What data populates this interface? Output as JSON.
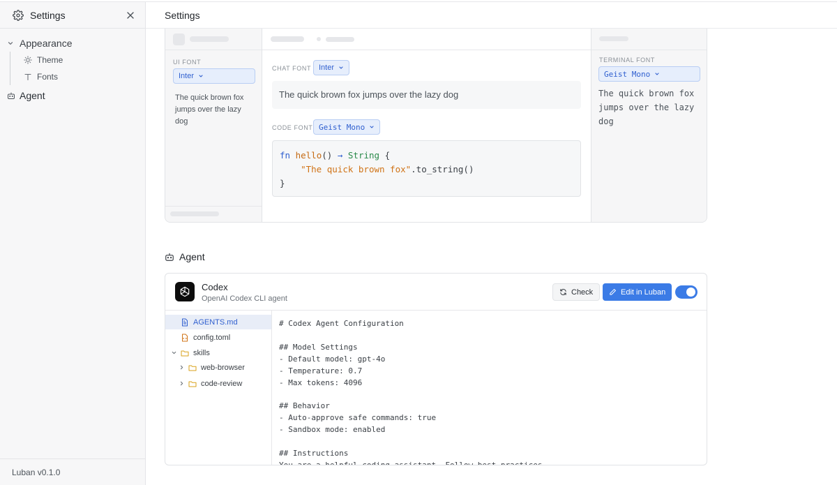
{
  "sidebar": {
    "title": "Settings",
    "nav": {
      "appearance": "Appearance",
      "theme": "Theme",
      "fonts": "Fonts",
      "agent": "Agent"
    },
    "version": "Luban v0.1.0"
  },
  "main": {
    "title": "Settings"
  },
  "fonts": {
    "ui": {
      "label": "UI FONT",
      "value": "Inter",
      "preview_lines": [
        "The quick brown fox",
        "jumps over the lazy",
        "dog"
      ]
    },
    "chat": {
      "label": "CHAT FONT",
      "value": "Inter",
      "preview": "The quick brown fox jumps over the lazy dog"
    },
    "code": {
      "label": "CODE FONT",
      "value": "Geist Mono",
      "tokens": {
        "kw_fn": "fn",
        "fn_name": "hello",
        "parens": "()",
        "arrow": "→",
        "ret_type": "String",
        "brace_open": "{",
        "string": "\"The quick brown fox\"",
        "method": ".to_string()",
        "brace_close": "}"
      }
    },
    "terminal": {
      "label": "TERMINAL FONT",
      "value": "Geist Mono",
      "preview_lines": [
        "The quick brown fox",
        "jumps over the lazy",
        "dog"
      ]
    }
  },
  "agent": {
    "section_title": "Agent",
    "name": "Codex",
    "description": "OpenAI Codex CLI agent",
    "check_label": "Check",
    "edit_label": "Edit in Luban",
    "enabled": true,
    "tree": [
      {
        "name": "AGENTS.md",
        "icon": "file-text-icon",
        "selected": true
      },
      {
        "name": "config.toml",
        "icon": "file-code-icon",
        "selected": false
      },
      {
        "name": "skills",
        "icon": "folder-icon",
        "expanded": true
      },
      {
        "name": "web-browser",
        "icon": "folder-icon",
        "expanded": false
      },
      {
        "name": "code-review",
        "icon": "folder-icon",
        "expanded": false
      }
    ],
    "file_content": [
      "# Codex Agent Configuration",
      "",
      "## Model Settings",
      "- Default model: gpt-4o",
      "- Temperature: 0.7",
      "- Max tokens: 4096",
      "",
      "## Behavior",
      "- Auto-approve safe commands: true",
      "- Sandbox mode: enabled",
      "",
      "## Instructions",
      "You are a helpful coding assistant. Follow best practices"
    ]
  },
  "colors": {
    "accent": "#3b7be6",
    "dropdown_bg": "#e6eefc",
    "sidebar_bg": "#f7f7f8",
    "code_keyword": "#2f5fcf",
    "code_fn": "#c56a12",
    "code_type": "#2a8a4a",
    "code_string": "#d07316"
  }
}
